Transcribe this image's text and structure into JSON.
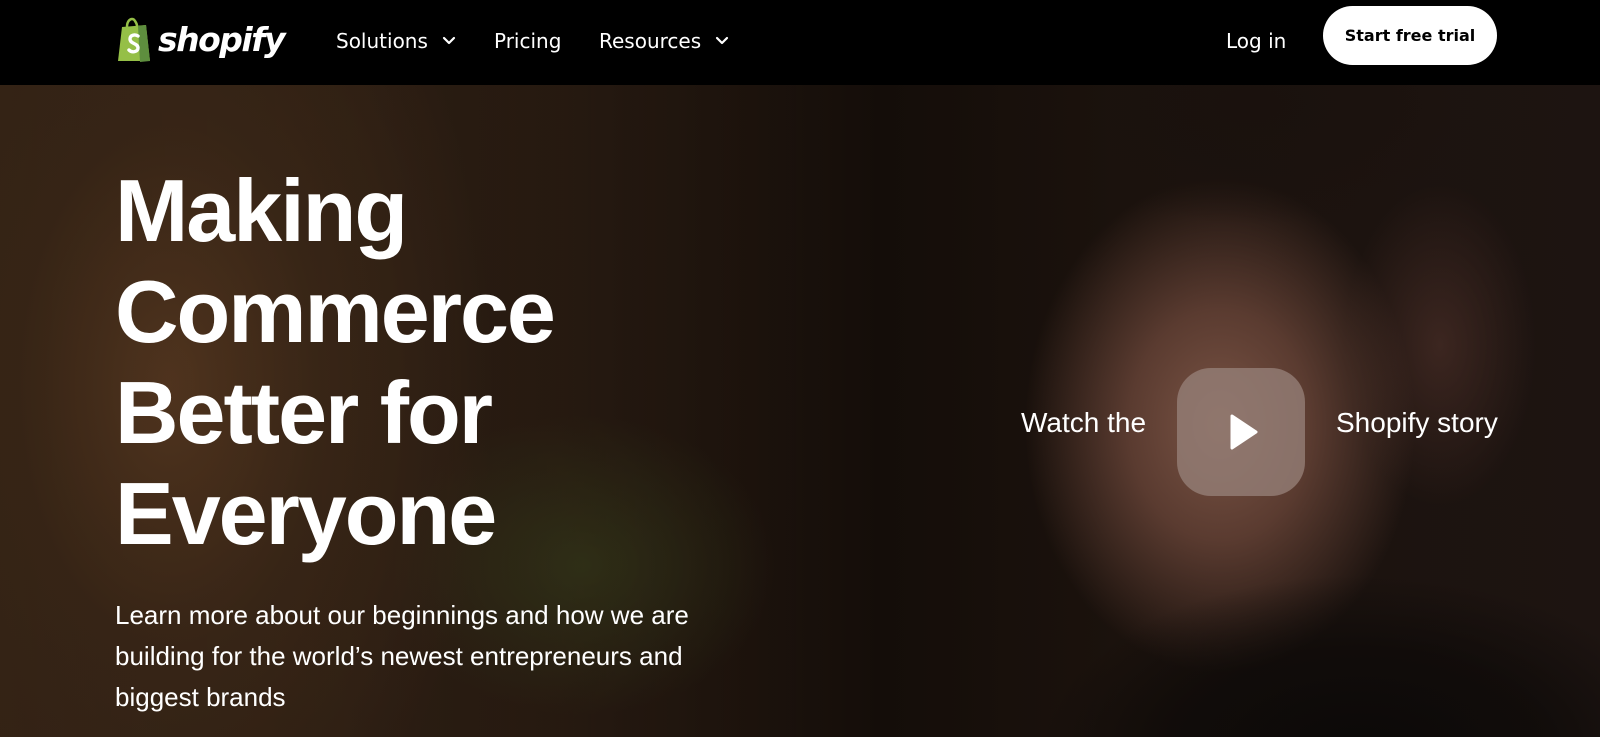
{
  "brand": {
    "name": "shopify",
    "logo_icon": "shopping-bag-logo",
    "green": "#95bf47"
  },
  "nav": {
    "items": [
      {
        "label": "Solutions",
        "has_dropdown": true
      },
      {
        "label": "Pricing",
        "has_dropdown": false
      },
      {
        "label": "Resources",
        "has_dropdown": true
      }
    ],
    "login_label": "Log in",
    "cta_label": "Start free trial"
  },
  "hero": {
    "headline_lines": [
      "Making",
      "Commerce",
      "Better for",
      "Everyone"
    ],
    "subtitle": "Learn more about our beginnings and how we are building for the world’s newest entrepreneurs and biggest brands",
    "video": {
      "label_left": "Watch the",
      "label_right": "Shopify story",
      "play_icon": "play-icon"
    }
  }
}
